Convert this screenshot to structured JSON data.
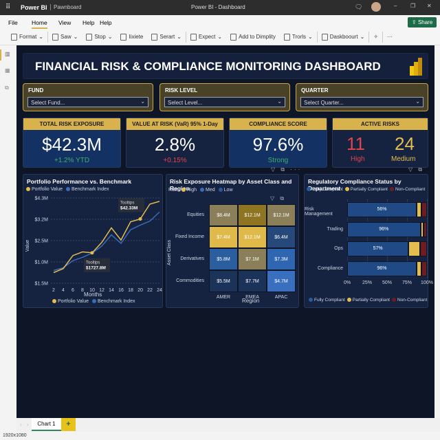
{
  "titlebar": {
    "app": "Power BI",
    "workspace": "Pawnboard",
    "doc_title": "Power BI - Dashboard"
  },
  "menu": {
    "items": [
      "File",
      "Home",
      "View",
      "Help",
      "Help"
    ],
    "active": "Home",
    "share": "Share"
  },
  "toolbar": {
    "items": [
      "Format",
      "Saw",
      "Stop",
      "Iixiete",
      "Serart",
      "Expect",
      "Add to Dimplity",
      "Trorls",
      "Daskboourt"
    ]
  },
  "dashboard": {
    "title": "FINANCIAL RISK & COMPLIANCE MONITORING DASHBOARD"
  },
  "slicers": [
    {
      "label": "FUND",
      "placeholder": "Select Fund..."
    },
    {
      "label": "RISK LEVEL",
      "placeholder": "Select Level..."
    },
    {
      "label": "QUARTER",
      "placeholder": "Select Quarter..."
    }
  ],
  "kpis": {
    "total": {
      "title": "TOTAL RISK EXPOSURE",
      "value": "$42.3M",
      "sub": "+1.2% YTD"
    },
    "var": {
      "title": "VALUE AT RISK (VaR) 95% 1-Day",
      "value": "2.8%",
      "sub": "+0.15%"
    },
    "compliance": {
      "title": "COMPLIANCE SCORE",
      "value": "97.6%",
      "sub": "Strong"
    },
    "active": {
      "title": "ACTIVE RISKS",
      "high": "11",
      "high_label": "High",
      "medium": "24",
      "medium_label": "Medium"
    }
  },
  "colors": {
    "gold": "#e3bd4f",
    "blue": "#3a6cb8",
    "red": "#e0454c",
    "green": "#3fae6a",
    "dark_red": "#7a1f24"
  },
  "chart_data": [
    {
      "type": "line",
      "title": "Portfolio Performance vs. Benchmark",
      "xlabel": "Months",
      "ylabel": "Value",
      "x": [
        2,
        4,
        6,
        8,
        10,
        12,
        14,
        16,
        18,
        20,
        22,
        24
      ],
      "ytick_labels": [
        "$1.5M",
        "$1.0M",
        "$2.5M",
        "$3.2M",
        "$4.3M"
      ],
      "ylim": [
        1.5,
        4.3
      ],
      "series": [
        {
          "name": "Portfolio Value",
          "color": "#e3bd4f",
          "values": [
            1.85,
            1.98,
            2.41,
            2.53,
            2.5,
            2.84,
            3.32,
            2.92,
            3.52,
            3.61,
            4.1,
            4.19
          ]
        },
        {
          "name": "Benchmark Index",
          "color": "#3a6cb8",
          "values": [
            1.92,
            2.01,
            2.24,
            2.35,
            2.49,
            2.72,
            3.09,
            2.81,
            3.26,
            3.41,
            3.54,
            3.84
          ]
        }
      ],
      "annotations": [
        {
          "x": 20,
          "label": "Tooltips",
          "value": "$42.33M"
        },
        {
          "x": 10,
          "label": "Tooltips",
          "value": "$1727.8M"
        }
      ],
      "legend": "top"
    },
    {
      "type": "heatmap",
      "title": "Risk Exposure Heatmap by Asset Class and Region",
      "xlabel": "Region",
      "ylabel": "Asset Class",
      "legend_title": "Risk",
      "legend": [
        "High",
        "Med",
        "Low"
      ],
      "columns": [
        "AMER",
        "EMEA",
        "APAC"
      ],
      "rows": [
        "Equities",
        "Fixed Income",
        "Derivatives",
        "Commodities"
      ],
      "values": [
        [
          "$8.4M",
          "$12.1M",
          "$12.1M"
        ],
        [
          "$7.4M",
          "$12.1M",
          "$6.4M"
        ],
        [
          "$5.8M",
          "$7.1M",
          "$7.3M"
        ],
        [
          "$5.5M",
          "$7.7M",
          "$4.7M"
        ]
      ],
      "cell_colors": [
        [
          "#8a7f58",
          "#8f7422",
          "#8a7f58"
        ],
        [
          "#dfba4a",
          "#dfba4a",
          "#27487a"
        ],
        [
          "#2b5e9f",
          "#8a7f58",
          "#2f66b1"
        ],
        [
          "#1b3358",
          "#1b3358",
          "#3a6fc0"
        ]
      ]
    },
    {
      "type": "bar",
      "stacked": true,
      "orientation": "horizontal",
      "title": "Regulatory Compliance Status by Department",
      "categories": [
        "Risk Management",
        "Trading",
        "Ops",
        "Compliance"
      ],
      "bar_labels": [
        "56%",
        "96%",
        "57%",
        "96%"
      ],
      "xtick_labels": [
        "0%",
        "25%",
        "50%",
        "75%",
        "100%"
      ],
      "xlim": [
        0,
        100
      ],
      "series": [
        {
          "name": "Fully Compliant",
          "color": "#1f4a86",
          "values": [
            87,
            92,
            77,
            87
          ]
        },
        {
          "name": "Partially Compliant",
          "color": "#e3bd4f",
          "values": [
            6,
            4,
            14,
            6
          ]
        },
        {
          "name": "Non-Compliant",
          "color": "#6e1c22",
          "values": [
            7,
            4,
            9,
            7
          ]
        }
      ],
      "legend": "top"
    }
  ],
  "pages": {
    "tabs": [
      "Chart 1"
    ],
    "add": "+"
  },
  "status": {
    "resolution": "1920x1080"
  }
}
